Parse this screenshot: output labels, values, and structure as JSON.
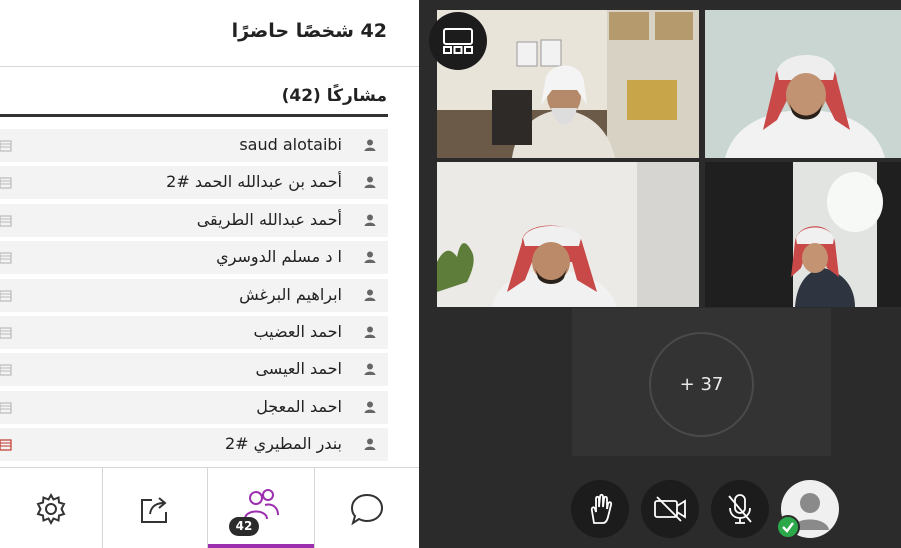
{
  "panel": {
    "title": "42 شخصًا حاضرًا",
    "participants_heading": "مشاركًا (42)"
  },
  "participants": [
    {
      "name": "saud alotaibi",
      "hand_color": "#bbbbbb"
    },
    {
      "name": "أحمد بن عبدالله الحمد #2",
      "hand_color": "#bbbbbb"
    },
    {
      "name": "أحمد عبدالله الطريقى",
      "hand_color": "#bbbbbb"
    },
    {
      "name": "ا د مسلم الدوسري",
      "hand_color": "#bbbbbb"
    },
    {
      "name": "ابراهيم البرغش",
      "hand_color": "#bbbbbb"
    },
    {
      "name": "احمد العضيب",
      "hand_color": "#bbbbbb"
    },
    {
      "name": "احمد العيسى",
      "hand_color": "#bbbbbb"
    },
    {
      "name": "احمد المعجل",
      "hand_color": "#bbbbbb"
    },
    {
      "name": "بندر المطيري #2",
      "hand_color": "#c0392b"
    }
  ],
  "toolbar": {
    "people_count": "42",
    "active_tab": "people",
    "accent_color": "#9b2fae",
    "icons": [
      "settings-icon",
      "share-icon",
      "people-icon",
      "chat-icon"
    ]
  },
  "video": {
    "more_participants_label": "37 +",
    "tiles": [
      "video-tile-1",
      "video-tile-2",
      "video-tile-3",
      "video-tile-4"
    ]
  },
  "controls": {
    "icons": [
      "raise-hand-icon",
      "camera-off-icon",
      "mic-off-icon",
      "self-avatar"
    ],
    "status_color": "#2aa84a"
  }
}
